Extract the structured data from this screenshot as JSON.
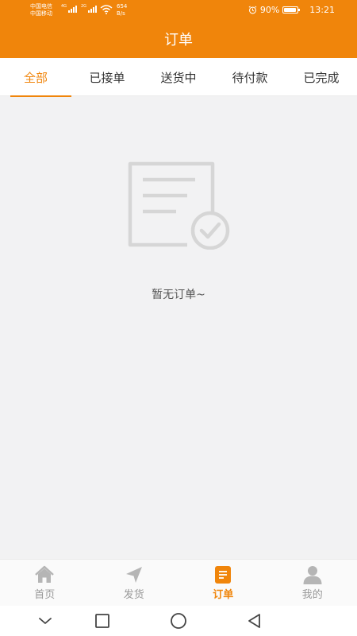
{
  "status_bar": {
    "carrier1": "中国电信",
    "carrier2": "中国移动",
    "sig1_label": "4G",
    "sig2_label": "2G",
    "net_speed": "654",
    "net_unit": "B/s",
    "battery": "90%",
    "battery_level": 0.9,
    "time": "13:21"
  },
  "header": {
    "title": "订单"
  },
  "tabs": [
    {
      "label": "全部",
      "active": true
    },
    {
      "label": "已接单",
      "active": false
    },
    {
      "label": "送货中",
      "active": false
    },
    {
      "label": "待付款",
      "active": false
    },
    {
      "label": "已完成",
      "active": false
    }
  ],
  "empty_state": {
    "icon": "empty-document-check-icon",
    "text": "暂无订单~"
  },
  "bottom_nav": [
    {
      "label": "首页",
      "icon": "home-icon",
      "active": false
    },
    {
      "label": "发货",
      "icon": "send-icon",
      "active": false
    },
    {
      "label": "订单",
      "icon": "order-icon",
      "active": true
    },
    {
      "label": "我的",
      "icon": "person-icon",
      "active": false
    }
  ],
  "system_nav": [
    "chevron-down-icon",
    "recents-square-icon",
    "home-circle-icon",
    "back-triangle-icon"
  ],
  "colors": {
    "accent": "#f0850b",
    "background": "#f2f2f3",
    "inactive": "#999999"
  }
}
